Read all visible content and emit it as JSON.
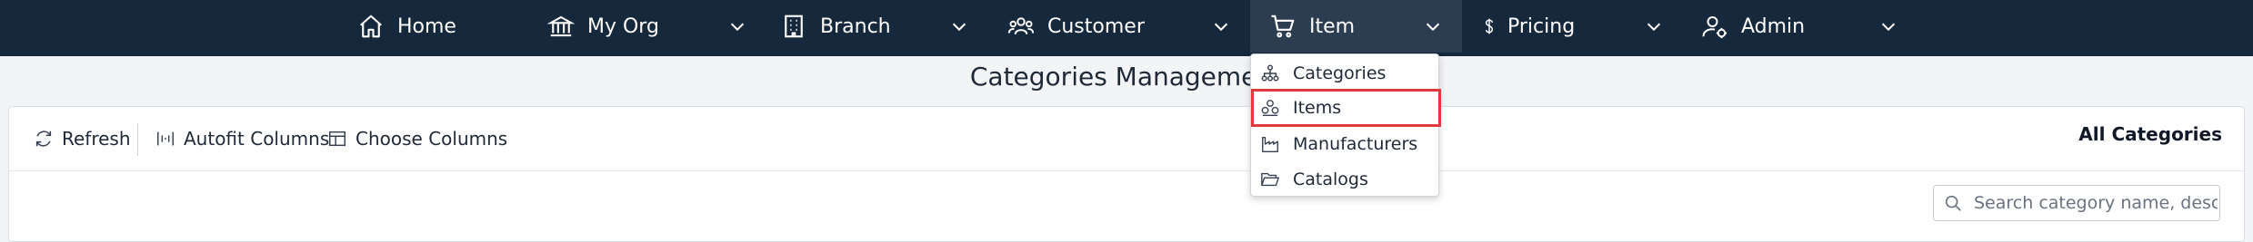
{
  "nav": {
    "items": [
      {
        "label": "Home",
        "icon": "home-icon"
      },
      {
        "label": "My Org",
        "icon": "bank-icon"
      },
      {
        "label": "Branch",
        "icon": "building-icon"
      },
      {
        "label": "Customer",
        "icon": "users-icon"
      },
      {
        "label": "Item",
        "icon": "cart-icon",
        "active": true
      },
      {
        "label": "Pricing",
        "icon": "dollar-icon"
      },
      {
        "label": "Admin",
        "icon": "admin-user-icon"
      }
    ]
  },
  "dropdown": {
    "items": [
      {
        "label": "Categories",
        "icon": "sitemap-icon"
      },
      {
        "label": "Items",
        "icon": "boxes-icon",
        "highlighted": true
      },
      {
        "label": "Manufacturers",
        "icon": "factory-icon"
      },
      {
        "label": "Catalogs",
        "icon": "folder-open-icon"
      }
    ]
  },
  "page": {
    "title": "Categories Management"
  },
  "toolbar": {
    "refresh_label": "Refresh",
    "autofit_label": "Autofit Columns",
    "choose_columns_label": "Choose Columns",
    "filter_label": "All Categories"
  },
  "search": {
    "placeholder": "Search category name, desc..."
  },
  "colors": {
    "nav_background": "#16283b",
    "nav_active": "#2c3d51",
    "highlight_border": "#e0393e"
  }
}
